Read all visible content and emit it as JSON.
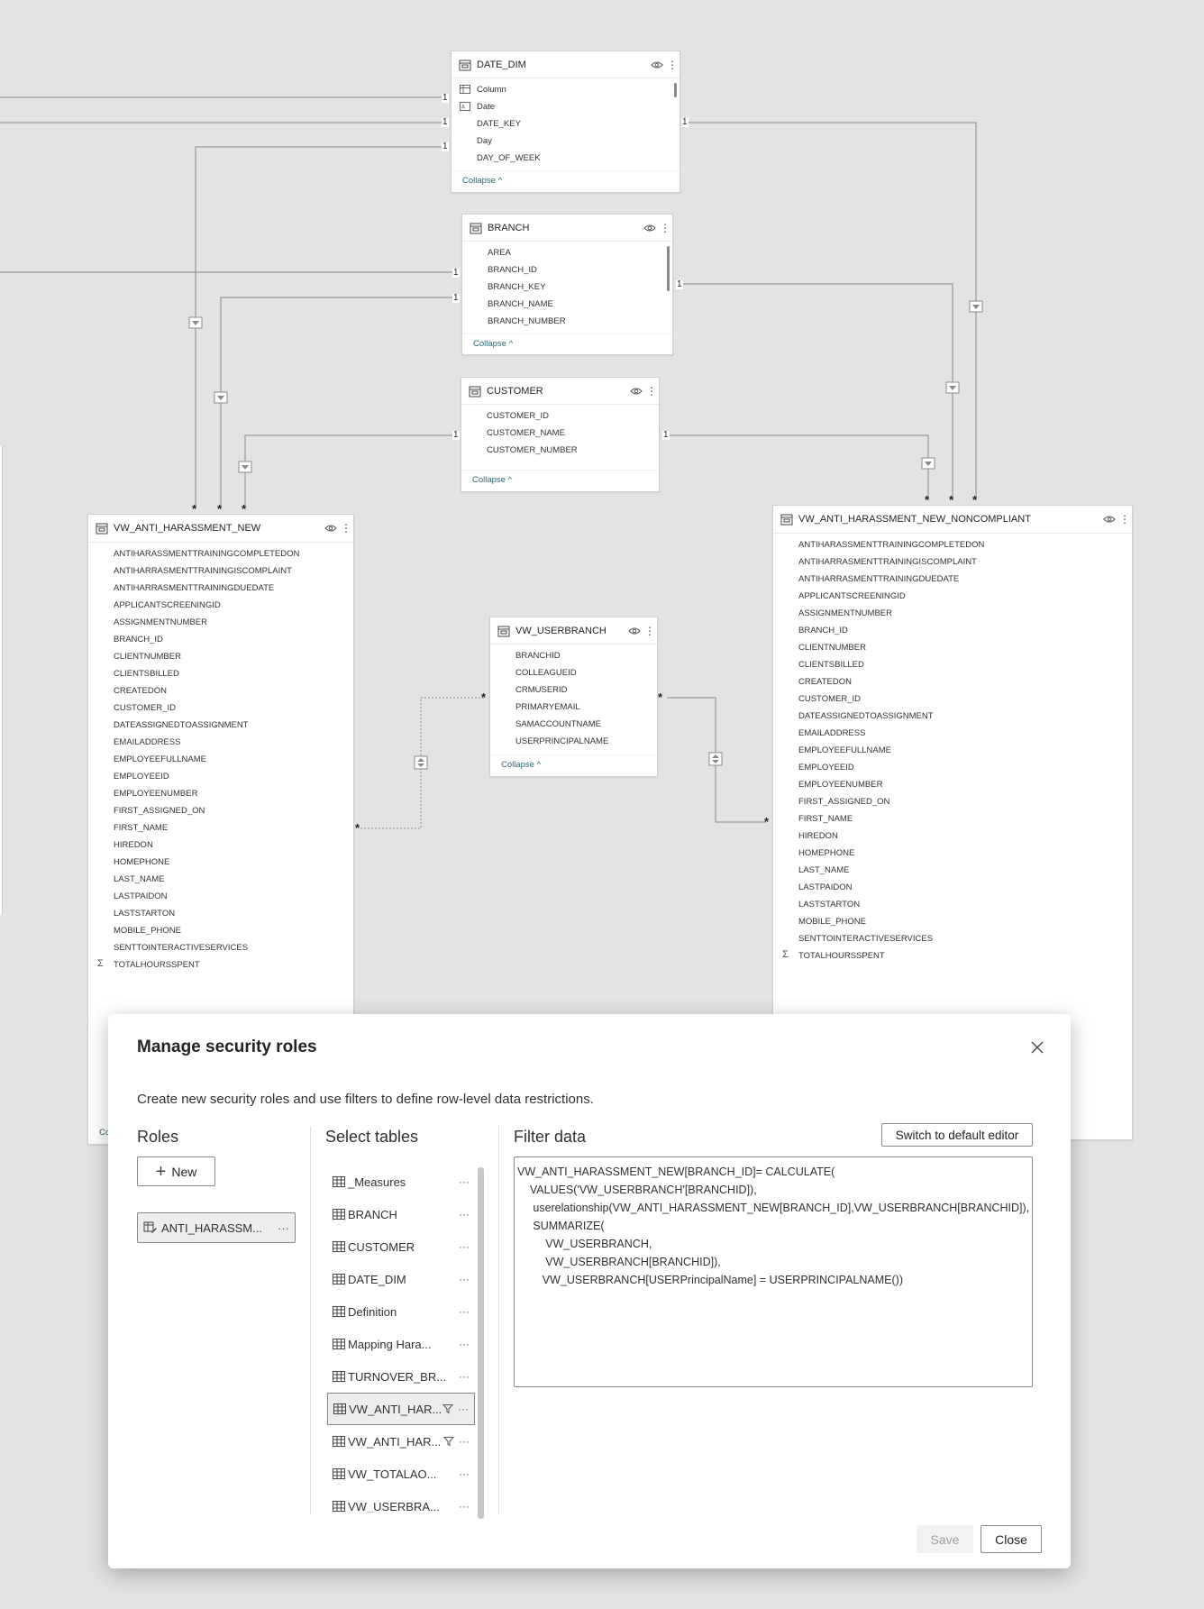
{
  "tables": {
    "date_dim": {
      "title": "DATE_DIM",
      "fields": [
        {
          "name": "Column",
          "icon": "calc-column-icon"
        },
        {
          "name": "Date",
          "icon": "text-field-icon"
        },
        {
          "name": "DATE_KEY",
          "icon": ""
        },
        {
          "name": "Day",
          "icon": ""
        },
        {
          "name": "DAY_OF_WEEK",
          "icon": ""
        }
      ],
      "collapse": "Collapse"
    },
    "branch": {
      "title": "BRANCH",
      "fields": [
        "AREA",
        "BRANCH_ID",
        "BRANCH_KEY",
        "BRANCH_NAME",
        "BRANCH_NUMBER"
      ],
      "collapse": "Collapse"
    },
    "customer": {
      "title": "CUSTOMER",
      "fields": [
        "CUSTOMER_ID",
        "CUSTOMER_NAME",
        "CUSTOMER_NUMBER"
      ],
      "collapse": "Collapse"
    },
    "vw_userbranch": {
      "title": "VW_USERBRANCH",
      "fields": [
        "BRANCHID",
        "COLLEAGUEID",
        "CRMUSERID",
        "PRIMARYEMAIL",
        "SAMACCOUNTNAME",
        "USERPRINCIPALNAME"
      ],
      "collapse": "Collapse"
    },
    "vw_anti_new": {
      "title": "VW_ANTI_HARASSMENT_NEW",
      "fields": [
        "ANTIHARASSMENTTRAININGCOMPLETEDON",
        "ANTIHARRASMENTTRAININGISCOMPLAINT",
        "ANTIHARRASMENTTRAININGDUEDATE",
        "APPLICANTSCREENINGID",
        "ASSIGNMENTNUMBER",
        "BRANCH_ID",
        "CLIENTNUMBER",
        "CLIENTSBILLED",
        "CREATEDON",
        "CUSTOMER_ID",
        "DATEASSIGNEDTOASSIGNMENT",
        "EMAILADDRESS",
        "EMPLOYEEFULLNAME",
        "EMPLOYEEID",
        "EMPLOYEENUMBER",
        "FIRST_ASSIGNED_ON",
        "FIRST_NAME",
        "HIREDON",
        "HOMEPHONE",
        "LAST_NAME",
        "LASTPAIDON",
        "LASTSTARTON",
        "MOBILE_PHONE",
        "SENTTOINTERACTIVESERVICES",
        "TOTALHOURSSPENT"
      ],
      "collapse_partial": "Co"
    },
    "vw_anti_noncompliant": {
      "title": "VW_ANTI_HARASSMENT_NEW_NONCOMPLIANT",
      "fields": [
        "ANTIHARASSMENTTRAININGCOMPLETEDON",
        "ANTIHARRASMENTTRAININGISCOMPLAINT",
        "ANTIHARRASMENTTRAININGDUEDATE",
        "APPLICANTSCREENINGID",
        "ASSIGNMENTNUMBER",
        "BRANCH_ID",
        "CLIENTNUMBER",
        "CLIENTSBILLED",
        "CREATEDON",
        "CUSTOMER_ID",
        "DATEASSIGNEDTOASSIGNMENT",
        "EMAILADDRESS",
        "EMPLOYEEFULLNAME",
        "EMPLOYEEID",
        "EMPLOYEENUMBER",
        "FIRST_ASSIGNED_ON",
        "FIRST_NAME",
        "HIREDON",
        "HOMEPHONE",
        "LAST_NAME",
        "LASTPAIDON",
        "LASTSTARTON",
        "MOBILE_PHONE",
        "SENTTOINTERACTIVESERVICES",
        "TOTALHOURSSPENT"
      ]
    }
  },
  "cardinality": {
    "one": "1",
    "many": "*"
  },
  "dialog": {
    "title": "Manage security roles",
    "subtitle": "Create new security roles and use filters to define row-level data restrictions.",
    "roles_heading": "Roles",
    "new_button": "New",
    "role_name": "ANTI_HARASSM...",
    "select_tables_heading": "Select tables",
    "tables": [
      {
        "label": "_Measures",
        "filtered": false,
        "selected": false
      },
      {
        "label": "BRANCH",
        "filtered": false,
        "selected": false
      },
      {
        "label": "CUSTOMER",
        "filtered": false,
        "selected": false
      },
      {
        "label": "DATE_DIM",
        "filtered": false,
        "selected": false
      },
      {
        "label": "Definition",
        "filtered": false,
        "selected": false
      },
      {
        "label": "Mapping Hara...",
        "filtered": false,
        "selected": false
      },
      {
        "label": "TURNOVER_BR...",
        "filtered": false,
        "selected": false
      },
      {
        "label": "VW_ANTI_HAR...",
        "filtered": true,
        "selected": true
      },
      {
        "label": "VW_ANTI_HAR...",
        "filtered": true,
        "selected": false
      },
      {
        "label": "VW_TOTALAO...",
        "filtered": false,
        "selected": false
      },
      {
        "label": "VW_USERBRA...",
        "filtered": false,
        "selected": false
      }
    ],
    "filter_heading": "Filter data",
    "switch_editor_button": "Switch to default editor",
    "dax": "VW_ANTI_HARASSMENT_NEW[BRANCH_ID]= CALCULATE(\n    VALUES('VW_USERBRANCH'[BRANCHID]),\n     userelationship(VW_ANTI_HARASSMENT_NEW[BRANCH_ID],VW_USERBRANCH[BRANCHID]),\n     SUMMARIZE(\n         VW_USERBRANCH,\n         VW_USERBRANCH[BRANCHID]),\n        VW_USERBRANCH[USERPrincipalName] = USERPRINCIPALNAME())",
    "save_button": "Save",
    "close_button": "Close"
  },
  "colors": {
    "canvas": "#e4e3e2",
    "link_teal": "#2a6b73",
    "line": "#8a8886",
    "selected_bg": "#ededed"
  }
}
